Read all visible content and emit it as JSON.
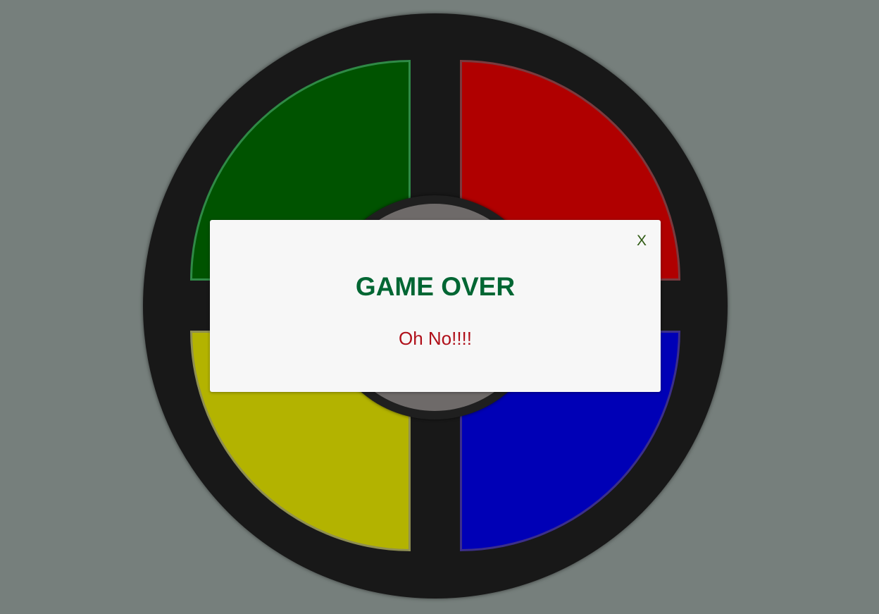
{
  "game": {
    "pads": {
      "green": {
        "color": "#005300"
      },
      "red": {
        "color": "#b00000"
      },
      "yellow": {
        "color": "#b3b300"
      },
      "blue": {
        "color": "#0000b6"
      }
    }
  },
  "modal": {
    "close_label": "X",
    "title": "GAME OVER",
    "message": "Oh No!!!!",
    "colors": {
      "close": "#2f5a12",
      "title": "#006633",
      "message": "#b0101a"
    }
  }
}
